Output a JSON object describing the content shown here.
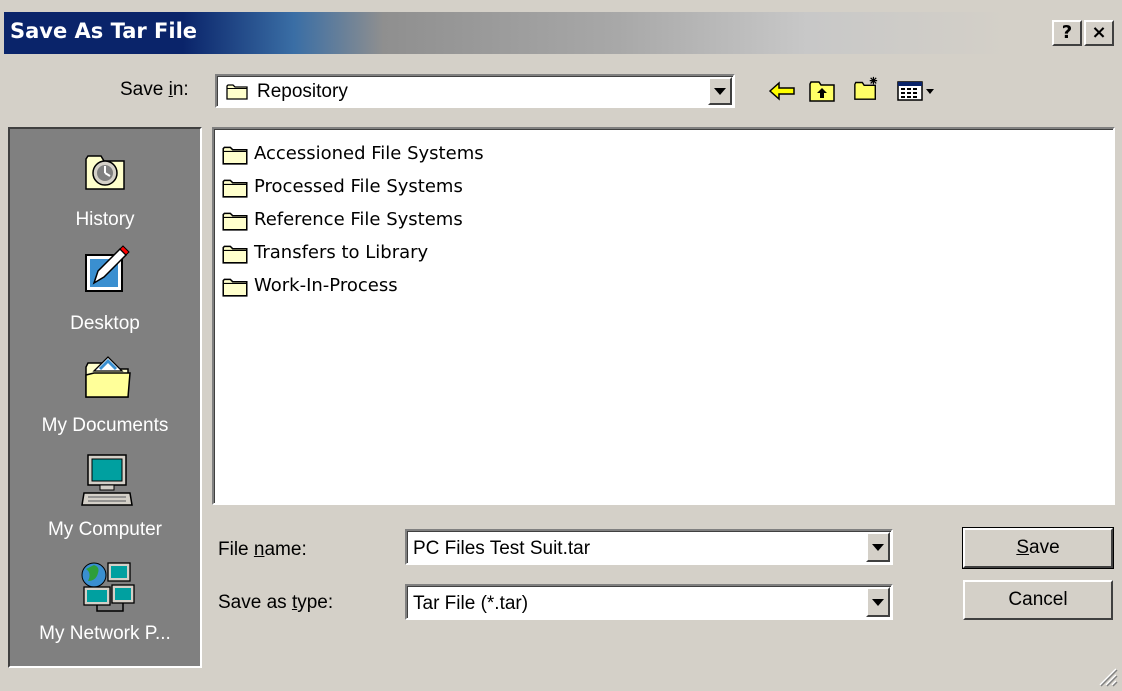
{
  "window": {
    "title": "Save As Tar File",
    "help_label": "?",
    "close_label": "×"
  },
  "save_in": {
    "label_pre": "Save ",
    "label_u": "i",
    "label_post": "n:",
    "value": "Repository"
  },
  "toolbar": {
    "back_icon": "back-arrow-icon",
    "up_icon": "up-folder-icon",
    "new_folder_icon": "new-folder-icon",
    "views_icon": "views-menu-icon"
  },
  "places": [
    {
      "label": "History",
      "icon": "history-icon"
    },
    {
      "label": "Desktop",
      "icon": "desktop-icon"
    },
    {
      "label": "My Documents",
      "icon": "my-documents-icon"
    },
    {
      "label": "My Computer",
      "icon": "my-computer-icon"
    },
    {
      "label": "My Network P...",
      "icon": "my-network-places-icon"
    }
  ],
  "files": [
    {
      "name": "Accessioned File Systems"
    },
    {
      "name": "Processed File Systems"
    },
    {
      "name": "Reference File Systems"
    },
    {
      "name": "Transfers to Library"
    },
    {
      "name": "Work-In-Process"
    }
  ],
  "filename": {
    "label_pre": "File ",
    "label_u": "n",
    "label_post": "ame:",
    "value": "PC Files Test Suit.tar"
  },
  "savetype": {
    "label_pre": "Save as ",
    "label_u": "t",
    "label_post": "ype:",
    "value": "Tar File (*.tar)"
  },
  "buttons": {
    "save_u": "S",
    "save_rest": "ave",
    "cancel": "Cancel"
  },
  "colors": {
    "title_active": "#0a246a",
    "face": "#d4d0c8",
    "places_bg": "#808080",
    "folder": "#ffffcc"
  }
}
